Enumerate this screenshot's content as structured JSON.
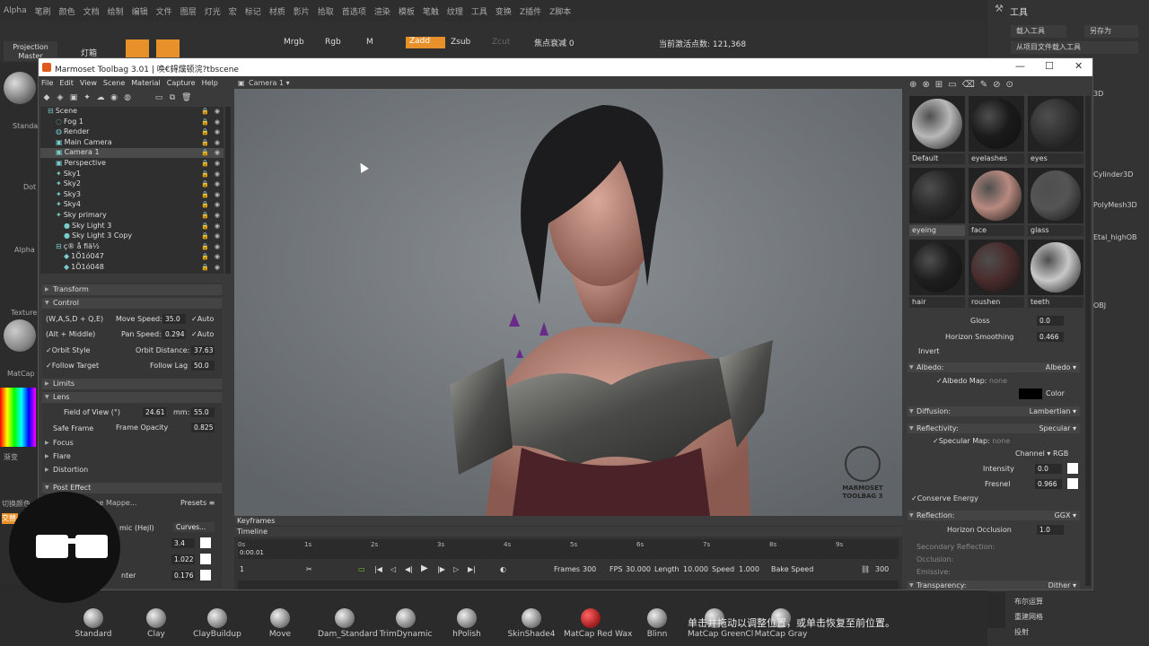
{
  "zbrush": {
    "menu": [
      "Alpha",
      "笔刷",
      "颜色",
      "文档",
      "绘制",
      "编辑",
      "文件",
      "图层",
      "灯光",
      "宏",
      "标记",
      "材质",
      "影片",
      "拾取",
      "首选项",
      "渲染",
      "模板",
      "笔触",
      "纹理",
      "工具",
      "变换",
      "Z插件",
      "Z脚本"
    ],
    "toolbar": {
      "projection_master": "Projection Master",
      "lightbox": "灯箱",
      "mrgb": "Mrgb",
      "rgb": "Rgb",
      "m": "M",
      "zadd": "Zadd",
      "zsub": "Zsub",
      "zcut": "Zcut",
      "focal_shift": "焦点衰减 0",
      "active_points": "当前激活点数: 121,368"
    },
    "right_panel": {
      "title": "工具",
      "load_tool": "载入工具",
      "save_as": "另存为",
      "load_from_project": "从项目文件载入工具",
      "items": [
        "Cylinder3D",
        "PolyMesh3D",
        "Etal_highOB",
        "OBJ"
      ],
      "bottom_items": [
        "布尔运算",
        "重建网格",
        "投射"
      ]
    },
    "left_labels": [
      "Standard",
      "Dot",
      "Alpha",
      "Texture",
      "MatCap",
      "渐变",
      "切换颜色",
      "交替"
    ],
    "brushes": [
      "Standard",
      "Clay",
      "ClayBuildup",
      "Move",
      "Dam_Standard",
      "TrimDynamic",
      "hPolish",
      "SkinShade4",
      "MatCap Red Wax",
      "Blinn",
      "MatCap GreenCl",
      "MatCap Gray"
    ],
    "caption": "单击并拖动以调整位置，或单击恢复至前位置。"
  },
  "toolbag": {
    "title": "Marmoset Toolbag 3.01  |  唤€鍀爣顿浣?tbscene",
    "menu": [
      "File",
      "Edit",
      "View",
      "Scene",
      "Material",
      "Capture",
      "Help"
    ],
    "camera_menu": "Camera 1 ▾",
    "scene_tree": [
      {
        "label": "Scene",
        "indent": 0,
        "icon": "⊟"
      },
      {
        "label": "Fog 1",
        "indent": 1,
        "icon": "◌"
      },
      {
        "label": "Render",
        "indent": 1,
        "icon": "◍"
      },
      {
        "label": "Main Camera",
        "indent": 1,
        "icon": "▣"
      },
      {
        "label": "Camera 1",
        "indent": 1,
        "icon": "▣",
        "selected": true
      },
      {
        "label": "Perspective",
        "indent": 1,
        "icon": "▣"
      },
      {
        "label": "Sky1",
        "indent": 1,
        "icon": "✦"
      },
      {
        "label": "Sky2",
        "indent": 1,
        "icon": "✦"
      },
      {
        "label": "Sky3",
        "indent": 1,
        "icon": "✦"
      },
      {
        "label": "Sky4",
        "indent": 1,
        "icon": "✦"
      },
      {
        "label": "Sky primary",
        "indent": 1,
        "icon": "✦"
      },
      {
        "label": "Sky Light 3",
        "indent": 2,
        "icon": "●"
      },
      {
        "label": "Sky Light 3 Copy",
        "indent": 2,
        "icon": "●"
      },
      {
        "label": "ç®  å  ﬁä½",
        "indent": 1,
        "icon": "⊟"
      },
      {
        "label": "1Õ1ó047",
        "indent": 2,
        "icon": "◆"
      },
      {
        "label": "1Õ1ó048",
        "indent": 2,
        "icon": "◆"
      }
    ],
    "props": {
      "transform": "Transform",
      "control": "Control",
      "wasd": "(W,A,S,D + Q,E)",
      "move_speed_label": "Move Speed:",
      "move_speed": "35.0",
      "auto": "Auto",
      "alt_middle": "(Alt + Middle)",
      "pan_speed_label": "Pan Speed:",
      "pan_speed": "0.294",
      "orbit_style": "Orbit Style",
      "orbit_distance_label": "Orbit Distance:",
      "orbit_distance": "37.63",
      "follow_target": "Follow Target",
      "follow_lag_label": "Follow Lag",
      "follow_lag": "50.0",
      "limits": "Limits",
      "lens": "Lens",
      "fov_label": "Field of View (°)",
      "fov": "24.61",
      "mm_label": "mm:",
      "mm": "55.0",
      "safe_frame": "Safe Frame",
      "frame_opacity_label": "Frame Opacity",
      "frame_opacity": "0.825",
      "focus": "Focus",
      "flare": "Flare",
      "distortion": "Distortion",
      "post_effect": "Post Effect",
      "tone_map": "Tone Mappe...",
      "presets": "Presets ≡",
      "dynamic": "mic (Hejl)",
      "curves": "Curves...",
      "val1": "3.4",
      "val2": "1.022",
      "val3": "0.176",
      "center": "nter"
    },
    "timeline": {
      "keyframes": "Keyframes",
      "timeline": "Timeline",
      "current": "0:00.01",
      "ticks": [
        "0s",
        "1s",
        "2s",
        "3s",
        "4s",
        "5s",
        "6s",
        "7s",
        "8s",
        "9s"
      ],
      "frame_field": "1",
      "frames_label": "Frames",
      "frames": "300",
      "fps_label": "FPS",
      "fps": "30.000",
      "length_label": "Length",
      "length": "10.000",
      "speed_label": "Speed",
      "speed": "1.000",
      "bake_speed": "Bake Speed",
      "end_frame": "300"
    },
    "materials": [
      {
        "name": "Default",
        "color": "#b8b8b8"
      },
      {
        "name": "eyelashes",
        "color": "#1a1a1a"
      },
      {
        "name": "eyes",
        "color": "#333"
      },
      {
        "name": "eyeing",
        "color": "#2a2a2a",
        "selected": true
      },
      {
        "name": "face",
        "color": "#b88a80"
      },
      {
        "name": "glass",
        "color": "#555"
      },
      {
        "name": "hair",
        "color": "#1e1e1e"
      },
      {
        "name": "roushen",
        "color": "#4a2c2c"
      },
      {
        "name": "teeth",
        "color": "#c8c8c8"
      }
    ],
    "mat_props": {
      "gloss_label": "Gloss",
      "gloss": "0.0",
      "horizon_smoothing_label": "Horizon Smoothing",
      "horizon_smoothing": "0.466",
      "invert": "Invert",
      "albedo": "Albedo:",
      "albedo_type": "Albedo ▾",
      "albedo_map": "Albedo Map:",
      "none": "none",
      "color": "Color",
      "diffusion": "Diffusion:",
      "diffusion_type": "Lambertian ▾",
      "reflectivity": "Reflectivity:",
      "reflectivity_type": "Specular ▾",
      "specular_map": "Specular Map:",
      "channel": "Channel ▾ RGB",
      "intensity_label": "Intensity",
      "intensity": "0.0",
      "fresnel_label": "Fresnel",
      "fresnel": "0.966",
      "conserve_energy": "Conserve Energy",
      "reflection": "Reflection:",
      "reflection_type": "GGX ▾",
      "horizon_occlusion_label": "Horizon Occlusion",
      "horizon_occlusion": "1.0",
      "secondary_reflection": "Secondary Reflection:",
      "occlusion": "Occlusion:",
      "emissive": "Emissive:",
      "transparency": "Transparency:",
      "transparency_type": "Dither ▾"
    },
    "watermark": "MARMOSET TOOLBAG 3"
  }
}
